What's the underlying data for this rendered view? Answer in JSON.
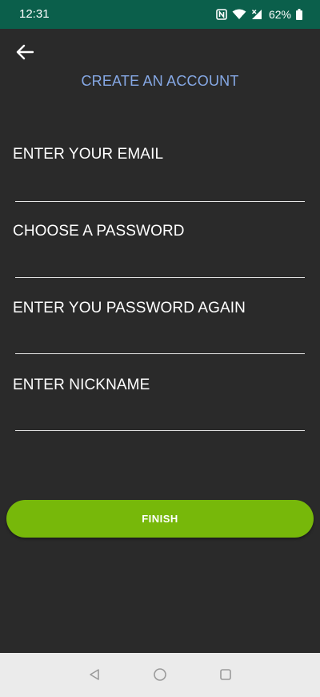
{
  "status_bar": {
    "time": "12:31",
    "battery": "62%",
    "icons": [
      "nfc-icon",
      "wifi-icon",
      "signal-icon",
      "battery-icon"
    ],
    "background": "#0b5f4b"
  },
  "header": {
    "back_icon": "arrow-left-icon",
    "title": "CREATE AN ACCOUNT",
    "title_color": "#86a9e6"
  },
  "form": {
    "fields": [
      {
        "label": "ENTER YOUR EMAIL",
        "value": "",
        "placeholder": ""
      },
      {
        "label": "CHOOSE A PASSWORD",
        "value": "",
        "placeholder": ""
      },
      {
        "label": "ENTER YOU PASSWORD AGAIN",
        "value": "",
        "placeholder": ""
      },
      {
        "label": "ENTER NICKNAME",
        "value": "",
        "placeholder": ""
      }
    ]
  },
  "actions": {
    "finish_label": "FINISH",
    "finish_color": "#77b80a"
  },
  "nav_bar": {
    "buttons": [
      "back-triangle-icon",
      "home-circle-icon",
      "recents-square-icon"
    ]
  }
}
